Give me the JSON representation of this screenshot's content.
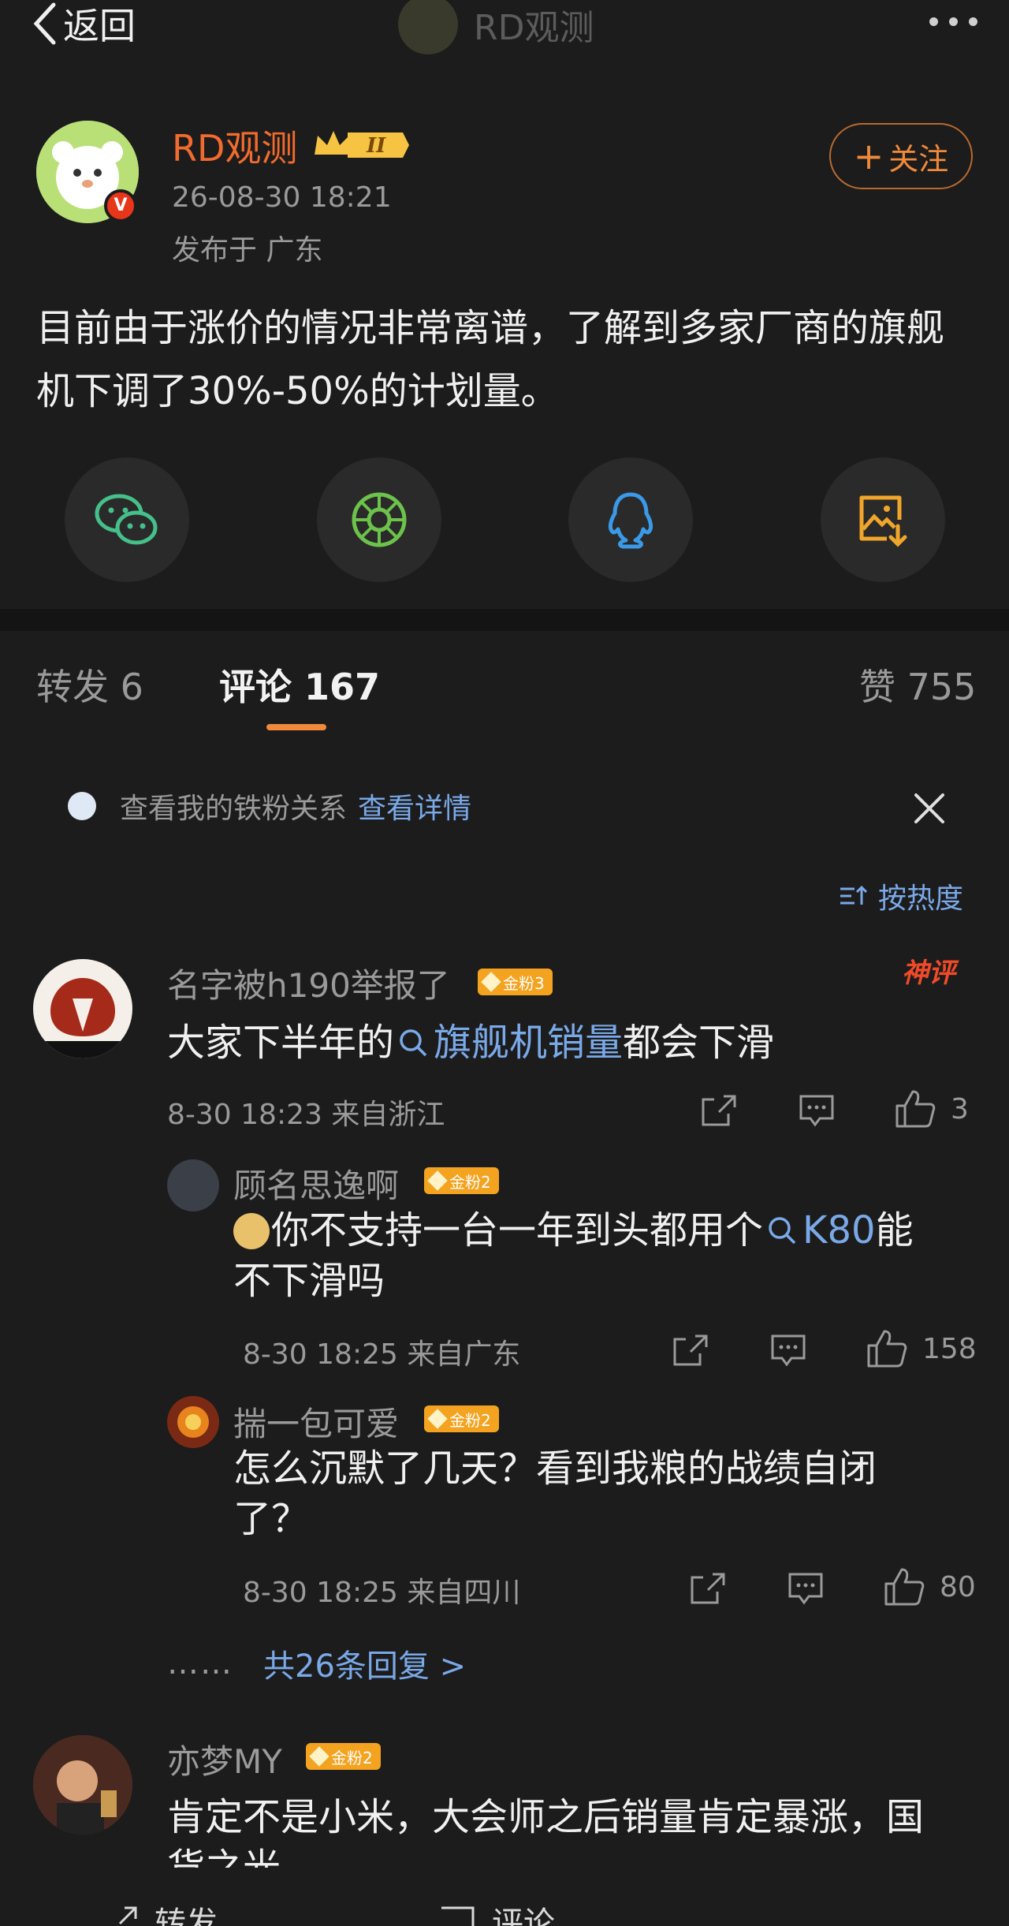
{
  "nav": {
    "back_label": "返回",
    "title": "RD观测"
  },
  "post": {
    "author": "RD观测",
    "level_badge": "II",
    "time": "26-08-30 18:21",
    "location": "发布于 广东",
    "follow_label": "关注",
    "text": "目前由于涨价的情况非常离谱，了解到多家厂商的旗舰机下调了30%-50%的计划量。"
  },
  "share": [
    "wechat-icon",
    "moments-icon",
    "qq-icon",
    "save-image-icon"
  ],
  "tabs": {
    "repost": "转发 6",
    "comments": "评论 167",
    "likes": "赞 755"
  },
  "fans": {
    "text": "查看我的铁粉关系",
    "link": "查看详情"
  },
  "sort_label": "按热度",
  "comments": [
    {
      "name": "名字被h190举报了",
      "badge": "金粉3",
      "tag": "神评",
      "text_pre": "大家下半年的",
      "topic": "旗舰机销量",
      "text_post": "都会下滑",
      "meta": "8-30 18:23 来自浙江",
      "likes": "3"
    }
  ],
  "replies": [
    {
      "name": "顾名思逸啊",
      "badge": "金粉2",
      "text_pre": "你不支持一台一年到头都用个",
      "topic": "K80",
      "text_post": "能不下滑吗",
      "meta": "8-30 18:25 来自广东",
      "likes": "158"
    },
    {
      "name": "揣一包可爱",
      "badge": "金粉2",
      "text": "怎么沉默了几天？看到我粮的战绩自闭了？",
      "meta": "8-30 18:25 来自四川",
      "likes": "80"
    }
  ],
  "more_replies": {
    "dots": "……",
    "label": "共26条回复 >"
  },
  "comment2": {
    "name": "亦梦MY",
    "badge": "金粉2",
    "text": "肯定不是小米，大会师之后销量肯定暴涨，国货之光"
  },
  "bottom": {
    "repost": "转发",
    "comment": "评论"
  }
}
